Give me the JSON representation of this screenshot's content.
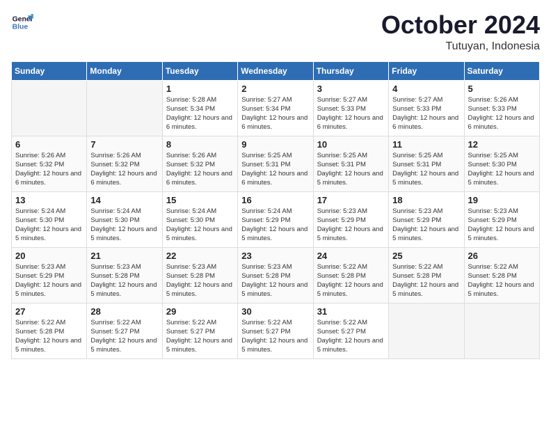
{
  "logo": {
    "line1": "General",
    "line2": "Blue"
  },
  "title": "October 2024",
  "location": "Tutuyan, Indonesia",
  "weekdays": [
    "Sunday",
    "Monday",
    "Tuesday",
    "Wednesday",
    "Thursday",
    "Friday",
    "Saturday"
  ],
  "weeks": [
    [
      {
        "day": null
      },
      {
        "day": null
      },
      {
        "day": "1",
        "sunrise": "Sunrise: 5:28 AM",
        "sunset": "Sunset: 5:34 PM",
        "daylight": "Daylight: 12 hours and 6 minutes."
      },
      {
        "day": "2",
        "sunrise": "Sunrise: 5:27 AM",
        "sunset": "Sunset: 5:34 PM",
        "daylight": "Daylight: 12 hours and 6 minutes."
      },
      {
        "day": "3",
        "sunrise": "Sunrise: 5:27 AM",
        "sunset": "Sunset: 5:33 PM",
        "daylight": "Daylight: 12 hours and 6 minutes."
      },
      {
        "day": "4",
        "sunrise": "Sunrise: 5:27 AM",
        "sunset": "Sunset: 5:33 PM",
        "daylight": "Daylight: 12 hours and 6 minutes."
      },
      {
        "day": "5",
        "sunrise": "Sunrise: 5:26 AM",
        "sunset": "Sunset: 5:33 PM",
        "daylight": "Daylight: 12 hours and 6 minutes."
      }
    ],
    [
      {
        "day": "6",
        "sunrise": "Sunrise: 5:26 AM",
        "sunset": "Sunset: 5:32 PM",
        "daylight": "Daylight: 12 hours and 6 minutes."
      },
      {
        "day": "7",
        "sunrise": "Sunrise: 5:26 AM",
        "sunset": "Sunset: 5:32 PM",
        "daylight": "Daylight: 12 hours and 6 minutes."
      },
      {
        "day": "8",
        "sunrise": "Sunrise: 5:26 AM",
        "sunset": "Sunset: 5:32 PM",
        "daylight": "Daylight: 12 hours and 6 minutes."
      },
      {
        "day": "9",
        "sunrise": "Sunrise: 5:25 AM",
        "sunset": "Sunset: 5:31 PM",
        "daylight": "Daylight: 12 hours and 6 minutes."
      },
      {
        "day": "10",
        "sunrise": "Sunrise: 5:25 AM",
        "sunset": "Sunset: 5:31 PM",
        "daylight": "Daylight: 12 hours and 5 minutes."
      },
      {
        "day": "11",
        "sunrise": "Sunrise: 5:25 AM",
        "sunset": "Sunset: 5:31 PM",
        "daylight": "Daylight: 12 hours and 5 minutes."
      },
      {
        "day": "12",
        "sunrise": "Sunrise: 5:25 AM",
        "sunset": "Sunset: 5:30 PM",
        "daylight": "Daylight: 12 hours and 5 minutes."
      }
    ],
    [
      {
        "day": "13",
        "sunrise": "Sunrise: 5:24 AM",
        "sunset": "Sunset: 5:30 PM",
        "daylight": "Daylight: 12 hours and 5 minutes."
      },
      {
        "day": "14",
        "sunrise": "Sunrise: 5:24 AM",
        "sunset": "Sunset: 5:30 PM",
        "daylight": "Daylight: 12 hours and 5 minutes."
      },
      {
        "day": "15",
        "sunrise": "Sunrise: 5:24 AM",
        "sunset": "Sunset: 5:30 PM",
        "daylight": "Daylight: 12 hours and 5 minutes."
      },
      {
        "day": "16",
        "sunrise": "Sunrise: 5:24 AM",
        "sunset": "Sunset: 5:29 PM",
        "daylight": "Daylight: 12 hours and 5 minutes."
      },
      {
        "day": "17",
        "sunrise": "Sunrise: 5:23 AM",
        "sunset": "Sunset: 5:29 PM",
        "daylight": "Daylight: 12 hours and 5 minutes."
      },
      {
        "day": "18",
        "sunrise": "Sunrise: 5:23 AM",
        "sunset": "Sunset: 5:29 PM",
        "daylight": "Daylight: 12 hours and 5 minutes."
      },
      {
        "day": "19",
        "sunrise": "Sunrise: 5:23 AM",
        "sunset": "Sunset: 5:29 PM",
        "daylight": "Daylight: 12 hours and 5 minutes."
      }
    ],
    [
      {
        "day": "20",
        "sunrise": "Sunrise: 5:23 AM",
        "sunset": "Sunset: 5:29 PM",
        "daylight": "Daylight: 12 hours and 5 minutes."
      },
      {
        "day": "21",
        "sunrise": "Sunrise: 5:23 AM",
        "sunset": "Sunset: 5:28 PM",
        "daylight": "Daylight: 12 hours and 5 minutes."
      },
      {
        "day": "22",
        "sunrise": "Sunrise: 5:23 AM",
        "sunset": "Sunset: 5:28 PM",
        "daylight": "Daylight: 12 hours and 5 minutes."
      },
      {
        "day": "23",
        "sunrise": "Sunrise: 5:23 AM",
        "sunset": "Sunset: 5:28 PM",
        "daylight": "Daylight: 12 hours and 5 minutes."
      },
      {
        "day": "24",
        "sunrise": "Sunrise: 5:22 AM",
        "sunset": "Sunset: 5:28 PM",
        "daylight": "Daylight: 12 hours and 5 minutes."
      },
      {
        "day": "25",
        "sunrise": "Sunrise: 5:22 AM",
        "sunset": "Sunset: 5:28 PM",
        "daylight": "Daylight: 12 hours and 5 minutes."
      },
      {
        "day": "26",
        "sunrise": "Sunrise: 5:22 AM",
        "sunset": "Sunset: 5:28 PM",
        "daylight": "Daylight: 12 hours and 5 minutes."
      }
    ],
    [
      {
        "day": "27",
        "sunrise": "Sunrise: 5:22 AM",
        "sunset": "Sunset: 5:28 PM",
        "daylight": "Daylight: 12 hours and 5 minutes."
      },
      {
        "day": "28",
        "sunrise": "Sunrise: 5:22 AM",
        "sunset": "Sunset: 5:27 PM",
        "daylight": "Daylight: 12 hours and 5 minutes."
      },
      {
        "day": "29",
        "sunrise": "Sunrise: 5:22 AM",
        "sunset": "Sunset: 5:27 PM",
        "daylight": "Daylight: 12 hours and 5 minutes."
      },
      {
        "day": "30",
        "sunrise": "Sunrise: 5:22 AM",
        "sunset": "Sunset: 5:27 PM",
        "daylight": "Daylight: 12 hours and 5 minutes."
      },
      {
        "day": "31",
        "sunrise": "Sunrise: 5:22 AM",
        "sunset": "Sunset: 5:27 PM",
        "daylight": "Daylight: 12 hours and 5 minutes."
      },
      {
        "day": null
      },
      {
        "day": null
      }
    ]
  ]
}
